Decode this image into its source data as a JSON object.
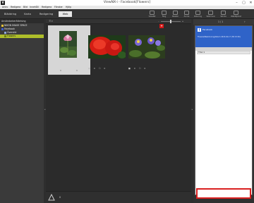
{
  "window": {
    "logo": "V",
    "title": "ViewNX-i - Facebook[Flowers]",
    "controls": [
      "–",
      "▢",
      "✕"
    ]
  },
  "menubar": [
    "Arkiv",
    "Redigera",
    "Bild",
    "Innehåll",
    "Redigera",
    "Fönster",
    "Hjälp"
  ],
  "tabs": [
    "Bläddring",
    "Karta",
    "Redigering",
    "Web"
  ],
  "toolbar_tools": [
    "ViewNX",
    "Färg",
    "Beskär",
    "Ändra",
    "Rotering",
    "Skärmval",
    "Skicka",
    "Webbtjänst"
  ],
  "left_panel": {
    "header": "Användarberättelsing",
    "tree": [
      {
        "label": "NIKON IMAGE SPACE",
        "selected": false
      },
      {
        "label": "Facebook",
        "selected": false
      },
      {
        "label": "Översikt",
        "selected": false
      },
      {
        "label": "Flowers",
        "selected": true
      }
    ]
  },
  "main_toolbar": {
    "view_button": "☰ ▾",
    "zoom_minus": "–",
    "zoom_plus": "+"
  },
  "thumbnails": [
    {
      "name": "pink-lotus",
      "caption_left": "0",
      "caption_right": "0",
      "selected": true
    },
    {
      "name": "red-flowers",
      "controls": [
        "■",
        "0",
        "☐",
        "0"
      ],
      "selected": false,
      "upload_marker": "+"
    },
    {
      "name": "blue-water-lilies",
      "controls": [
        "■",
        "0",
        "☐",
        "0"
      ],
      "selected": false
    }
  ],
  "bottom_bar": {
    "count": "0"
  },
  "right_panel": {
    "pager": "1 / 1",
    "service_header": "Facebook",
    "account_line": "Flowers/Beskrivning/Album 2013-02-17 (Till 15:30)",
    "caption_label": "Titel 1",
    "comment_value": ""
  },
  "colors": {
    "accent_green": "#aebe2a",
    "facebook_blue": "#2f63c8",
    "highlight_red": "#d92020"
  }
}
